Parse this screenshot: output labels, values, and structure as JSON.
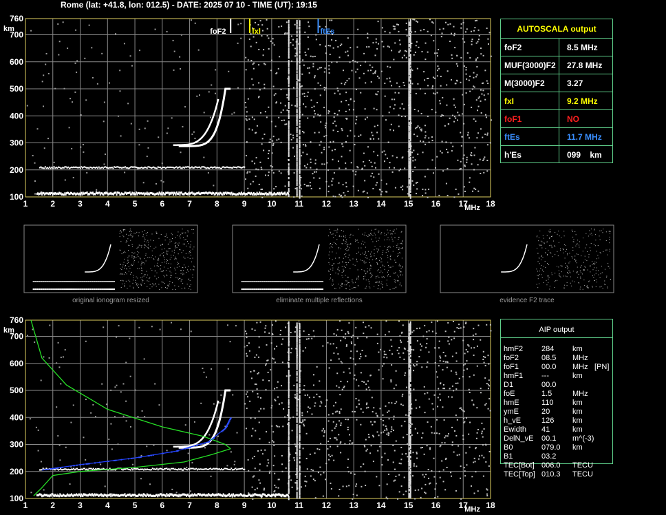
{
  "header": {
    "station_line": "Rome (lat: +41.8, lon: 012.5) - DATE: 2025 07 10 - TIME (UT): 19:15"
  },
  "chart_data": [
    {
      "type": "scatter",
      "name": "main-ionogram",
      "ylabel": "km",
      "xlabel": "MHz",
      "xlim": [
        1,
        18
      ],
      "ylim": [
        100,
        760
      ],
      "x_ticks": [
        1,
        2,
        3,
        4,
        5,
        6,
        7,
        8,
        9,
        10,
        11,
        12,
        13,
        14,
        15,
        16,
        17,
        18
      ],
      "y_ticks": [
        100,
        200,
        300,
        400,
        500,
        600,
        700,
        760
      ],
      "markers": [
        {
          "label": "foF2",
          "x": 8.5,
          "color": "#ffffff"
        },
        {
          "label": "fxl",
          "x": 9.2,
          "color": "#ffff00"
        },
        {
          "label": "ftEs",
          "x": 11.7,
          "color": "#3a8fff"
        }
      ]
    },
    {
      "type": "scatter",
      "name": "aip-ionogram",
      "ylabel": "km",
      "xlabel": "MHz",
      "xlim": [
        1,
        18
      ],
      "ylim": [
        100,
        760
      ],
      "x_ticks": [
        1,
        2,
        3,
        4,
        5,
        6,
        7,
        8,
        9,
        10,
        11,
        12,
        13,
        14,
        15,
        16,
        17,
        18
      ],
      "y_ticks": [
        100,
        200,
        300,
        400,
        500,
        600,
        700,
        760
      ],
      "profile_curve_green": [
        [
          8.5,
          284
        ],
        [
          8.3,
          300
        ],
        [
          7.5,
          330
        ],
        [
          6.0,
          365
        ],
        [
          4.0,
          430
        ],
        [
          2.5,
          520
        ],
        [
          1.6,
          620
        ],
        [
          1.2,
          760
        ]
      ],
      "profile_curve_blue": [
        [
          1.6,
          205
        ],
        [
          3.0,
          225
        ],
        [
          5.0,
          250
        ],
        [
          6.5,
          275
        ],
        [
          7.7,
          310
        ],
        [
          8.3,
          360
        ],
        [
          8.5,
          400
        ]
      ]
    }
  ],
  "thumbnails": [
    {
      "caption": "original ionogram resized"
    },
    {
      "caption": "eliminate multiple reflections"
    },
    {
      "caption": "evidence F2 trace"
    }
  ],
  "autoscala": {
    "title": "AUTOSCALA output",
    "rows": [
      {
        "key": "foF2",
        "value": "8.5 MHz",
        "color": "#ffffff"
      },
      {
        "key": "MUF(3000)F2",
        "value": "27.8 MHz",
        "color": "#ffffff"
      },
      {
        "key": "M(3000)F2",
        "value": "3.27",
        "color": "#ffffff"
      },
      {
        "key": "fxI",
        "value": "9.2 MHz",
        "color": "#ffff00"
      },
      {
        "key": "foF1",
        "value": "NO",
        "color": "#ff2020"
      },
      {
        "key": "ftEs",
        "value": "11.7 MHz",
        "color": "#3a8fff"
      },
      {
        "key": "h'Es",
        "value": "099    km",
        "color": "#ffffff"
      }
    ]
  },
  "aip": {
    "title": "AIP output",
    "rows": [
      {
        "name": "hmF2",
        "value": "284",
        "unit": "km",
        "extra": ""
      },
      {
        "name": "foF2",
        "value": "08.5",
        "unit": "MHz",
        "extra": ""
      },
      {
        "name": "foF1",
        "value": "00.0",
        "unit": "MHz",
        "extra": "[PN]"
      },
      {
        "name": "hmF1",
        "value": "---",
        "unit": "km",
        "extra": ""
      },
      {
        "name": "D1",
        "value": "00.0",
        "unit": "",
        "extra": ""
      },
      {
        "name": "foE",
        "value": "1.5",
        "unit": "MHz",
        "extra": ""
      },
      {
        "name": "hmE",
        "value": "110",
        "unit": "km",
        "extra": ""
      },
      {
        "name": "ymE",
        "value": "20",
        "unit": "km",
        "extra": ""
      },
      {
        "name": "h_vE",
        "value": "126",
        "unit": "km",
        "extra": ""
      },
      {
        "name": "Ewidth",
        "value": "41",
        "unit": "km",
        "extra": ""
      },
      {
        "name": "DelN_vE",
        "value": "00.1",
        "unit": "m^(-3)",
        "extra": ""
      },
      {
        "name": "B0",
        "value": "079.0",
        "unit": "km",
        "extra": ""
      },
      {
        "name": "B1",
        "value": "03.2",
        "unit": "",
        "extra": ""
      },
      {
        "name": "TEC[Bot]",
        "value": "006.0",
        "unit": "TECU",
        "extra": ""
      },
      {
        "name": "TEC[Top]",
        "value": "010.3",
        "unit": "TECU",
        "extra": ""
      }
    ]
  },
  "colors": {
    "grid": "#8a8a8a",
    "frame": "#e0d060",
    "table_border": "#5fcf8a",
    "trace": "#ffffff",
    "noise": "#bfbfbf"
  }
}
